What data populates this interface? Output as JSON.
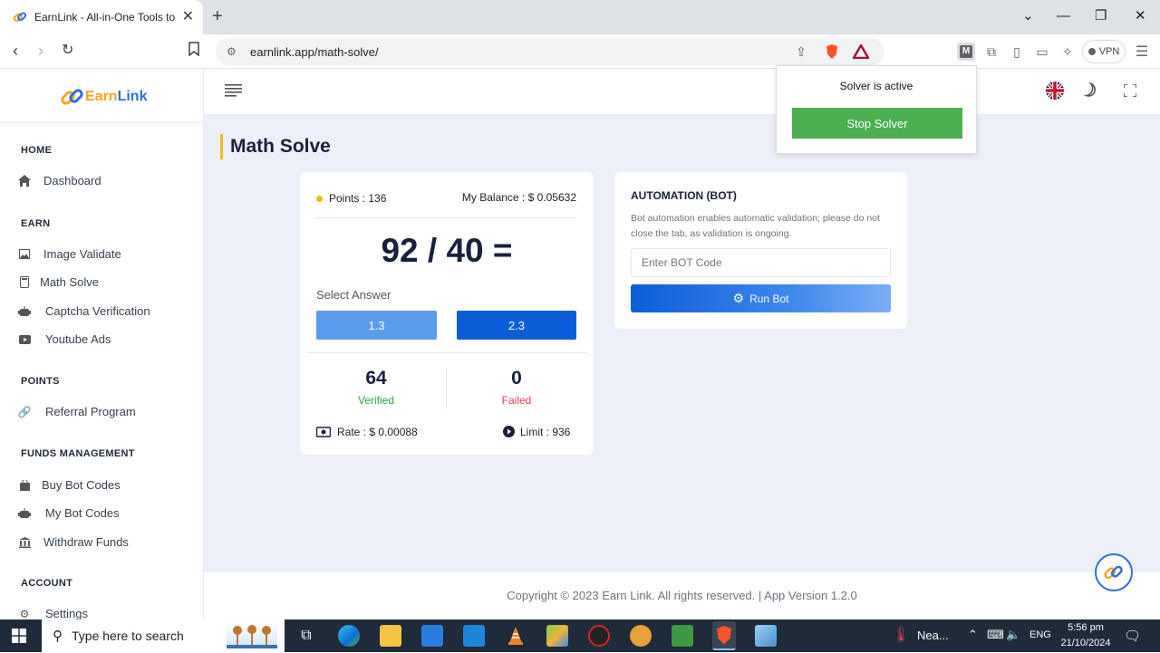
{
  "browser": {
    "tab_title": "EarnLink - All-in-One Tools to E",
    "tab_close": "✕",
    "new_tab": "+",
    "url": "earnlink.app/math-solve/",
    "vpn_label": "VPN",
    "window_controls": [
      "⌄",
      "—",
      "❐",
      "✕"
    ]
  },
  "sidebar": {
    "logo_prefix": "Earn",
    "logo_suffix": "Link",
    "sections": [
      {
        "title": "HOME",
        "items": [
          {
            "label": "Dashboard",
            "icon": "home-icon"
          }
        ]
      },
      {
        "title": "EARN",
        "items": [
          {
            "label": "Image Validate",
            "icon": "image-icon"
          },
          {
            "label": "Math Solve",
            "icon": "calculator-icon"
          },
          {
            "label": "Captcha Verification",
            "icon": "robot-icon"
          },
          {
            "label": "Youtube Ads",
            "icon": "youtube-icon"
          }
        ]
      },
      {
        "title": "POINTS",
        "items": [
          {
            "label": "Referral Program",
            "icon": "link-icon"
          }
        ]
      },
      {
        "title": "FUNDS MANAGEMENT",
        "items": [
          {
            "label": "Buy Bot Codes",
            "icon": "bag-icon"
          },
          {
            "label": "My Bot Codes",
            "icon": "robot-icon"
          },
          {
            "label": "Withdraw Funds",
            "icon": "bank-icon"
          }
        ]
      },
      {
        "title": "ACCOUNT",
        "items": [
          {
            "label": "Settings",
            "icon": "gear-icon"
          }
        ]
      }
    ]
  },
  "page": {
    "title": "Math Solve"
  },
  "math_card": {
    "points": "Points : 136",
    "balance": "My Balance : $ 0.05632",
    "equation": "92 / 40 =",
    "select_label": "Select Answer",
    "answers": [
      "1.3",
      "2.3"
    ],
    "verified_count": "64",
    "verified_label": "Verified",
    "failed_count": "0",
    "failed_label": "Failed",
    "rate": "Rate : $ 0.00088",
    "limit": "Limit : 936"
  },
  "bot_card": {
    "title": "AUTOMATION (BOT)",
    "description": "Bot automation enables automatic validation; please do not close the tab, as validation is ongoing.",
    "input_placeholder": "Enter BOT Code",
    "run_label": "Run Bot"
  },
  "solver_popup": {
    "status": "Solver is active",
    "stop_label": "Stop Solver"
  },
  "footer": {
    "text": "Copyright © 2023 Earn Link. All rights reserved. | App Version 1.2.0"
  },
  "taskbar": {
    "search_placeholder": "Type here to search",
    "weather": "Nea...",
    "language": "ENG",
    "time": "5:56 pm",
    "date": "21/10/2024"
  },
  "colors": {
    "accent_blue": "#0b5ed7",
    "light_blue": "#5a9cec",
    "green": "#4caf50",
    "verified_green": "#28a745",
    "failed_red": "#e0435c"
  }
}
